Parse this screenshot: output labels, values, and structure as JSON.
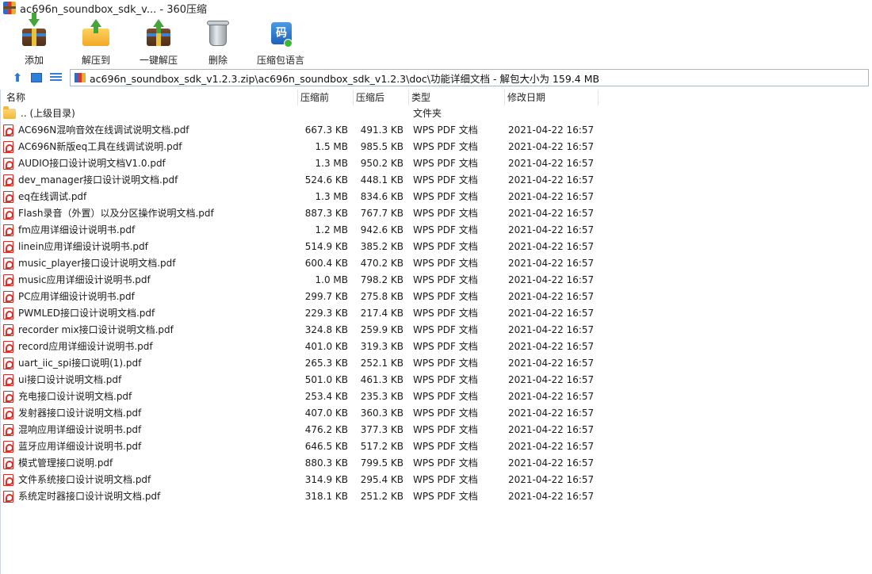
{
  "window": {
    "title": "ac696n_soundbox_sdk_v... - 360压缩"
  },
  "toolbar": {
    "buttons": [
      {
        "label": "添加",
        "icon": "add-archive-icon"
      },
      {
        "label": "解压到",
        "icon": "extract-to-icon"
      },
      {
        "label": "一键解压",
        "icon": "one-click-extract-icon"
      },
      {
        "label": "删除",
        "icon": "delete-icon"
      },
      {
        "label": "压缩包语言",
        "icon": "archive-language-icon"
      }
    ],
    "lang_icon_char": "码"
  },
  "address": {
    "path": "ac696n_soundbox_sdk_v1.2.3.zip\\ac696n_soundbox_sdk_v1.2.3\\doc\\功能详细文档 - 解包大小为 159.4 MB"
  },
  "columns": {
    "name": "名称",
    "before": "压缩前",
    "after": "压缩后",
    "type": "类型",
    "date": "修改日期"
  },
  "parent": {
    "name": ".. (上级目录)",
    "type": "文件夹"
  },
  "files": [
    {
      "name": "AC696N混响音效在线调试说明文档.pdf",
      "before": "667.3 KB",
      "after": "491.3 KB",
      "type": "WPS PDF 文档",
      "date": "2021-04-22 16:57"
    },
    {
      "name": "AC696N新版eq工具在线调试说明.pdf",
      "before": "1.5 MB",
      "after": "985.5 KB",
      "type": "WPS PDF 文档",
      "date": "2021-04-22 16:57"
    },
    {
      "name": "AUDIO接口设计说明文档V1.0.pdf",
      "before": "1.3 MB",
      "after": "950.2 KB",
      "type": "WPS PDF 文档",
      "date": "2021-04-22 16:57"
    },
    {
      "name": "dev_manager接口设计说明文档.pdf",
      "before": "524.6 KB",
      "after": "448.1 KB",
      "type": "WPS PDF 文档",
      "date": "2021-04-22 16:57"
    },
    {
      "name": "eq在线调试.pdf",
      "before": "1.3 MB",
      "after": "834.6 KB",
      "type": "WPS PDF 文档",
      "date": "2021-04-22 16:57"
    },
    {
      "name": "Flash录音（外置）以及分区操作说明文档.pdf",
      "before": "887.3 KB",
      "after": "767.7 KB",
      "type": "WPS PDF 文档",
      "date": "2021-04-22 16:57"
    },
    {
      "name": "fm应用详细设计说明书.pdf",
      "before": "1.2 MB",
      "after": "942.6 KB",
      "type": "WPS PDF 文档",
      "date": "2021-04-22 16:57"
    },
    {
      "name": "linein应用详细设计说明书.pdf",
      "before": "514.9 KB",
      "after": "385.2 KB",
      "type": "WPS PDF 文档",
      "date": "2021-04-22 16:57"
    },
    {
      "name": "music_player接口设计说明文档.pdf",
      "before": "600.4 KB",
      "after": "470.2 KB",
      "type": "WPS PDF 文档",
      "date": "2021-04-22 16:57"
    },
    {
      "name": "music应用详细设计说明书.pdf",
      "before": "1.0 MB",
      "after": "798.2 KB",
      "type": "WPS PDF 文档",
      "date": "2021-04-22 16:57"
    },
    {
      "name": "PC应用详细设计说明书.pdf",
      "before": "299.7 KB",
      "after": "275.8 KB",
      "type": "WPS PDF 文档",
      "date": "2021-04-22 16:57"
    },
    {
      "name": "PWMLED接口设计说明文档.pdf",
      "before": "229.3 KB",
      "after": "217.4 KB",
      "type": "WPS PDF 文档",
      "date": "2021-04-22 16:57"
    },
    {
      "name": "recorder mix接口设计说明文档.pdf",
      "before": "324.8 KB",
      "after": "259.9 KB",
      "type": "WPS PDF 文档",
      "date": "2021-04-22 16:57"
    },
    {
      "name": "record应用详细设计说明书.pdf",
      "before": "401.0 KB",
      "after": "319.3 KB",
      "type": "WPS PDF 文档",
      "date": "2021-04-22 16:57"
    },
    {
      "name": "uart_iic_spi接口说明(1).pdf",
      "before": "265.3 KB",
      "after": "252.1 KB",
      "type": "WPS PDF 文档",
      "date": "2021-04-22 16:57"
    },
    {
      "name": "ui接口设计说明文档.pdf",
      "before": "501.0 KB",
      "after": "461.3 KB",
      "type": "WPS PDF 文档",
      "date": "2021-04-22 16:57"
    },
    {
      "name": "充电接口设计说明文档.pdf",
      "before": "253.4 KB",
      "after": "235.3 KB",
      "type": "WPS PDF 文档",
      "date": "2021-04-22 16:57"
    },
    {
      "name": "发射器接口设计说明文档.pdf",
      "before": "407.0 KB",
      "after": "360.3 KB",
      "type": "WPS PDF 文档",
      "date": "2021-04-22 16:57"
    },
    {
      "name": "混响应用详细设计说明书.pdf",
      "before": "476.2 KB",
      "after": "377.3 KB",
      "type": "WPS PDF 文档",
      "date": "2021-04-22 16:57"
    },
    {
      "name": "蓝牙应用详细设计说明书.pdf",
      "before": "646.5 KB",
      "after": "517.2 KB",
      "type": "WPS PDF 文档",
      "date": "2021-04-22 16:57"
    },
    {
      "name": "模式管理接口说明.pdf",
      "before": "880.3 KB",
      "after": "799.5 KB",
      "type": "WPS PDF 文档",
      "date": "2021-04-22 16:57"
    },
    {
      "name": "文件系统接口设计说明文档.pdf",
      "before": "314.9 KB",
      "after": "295.4 KB",
      "type": "WPS PDF 文档",
      "date": "2021-04-22 16:57"
    },
    {
      "name": "系统定时器接口设计说明文档.pdf",
      "before": "318.1 KB",
      "after": "251.2 KB",
      "type": "WPS PDF 文档",
      "date": "2021-04-22 16:57"
    }
  ]
}
